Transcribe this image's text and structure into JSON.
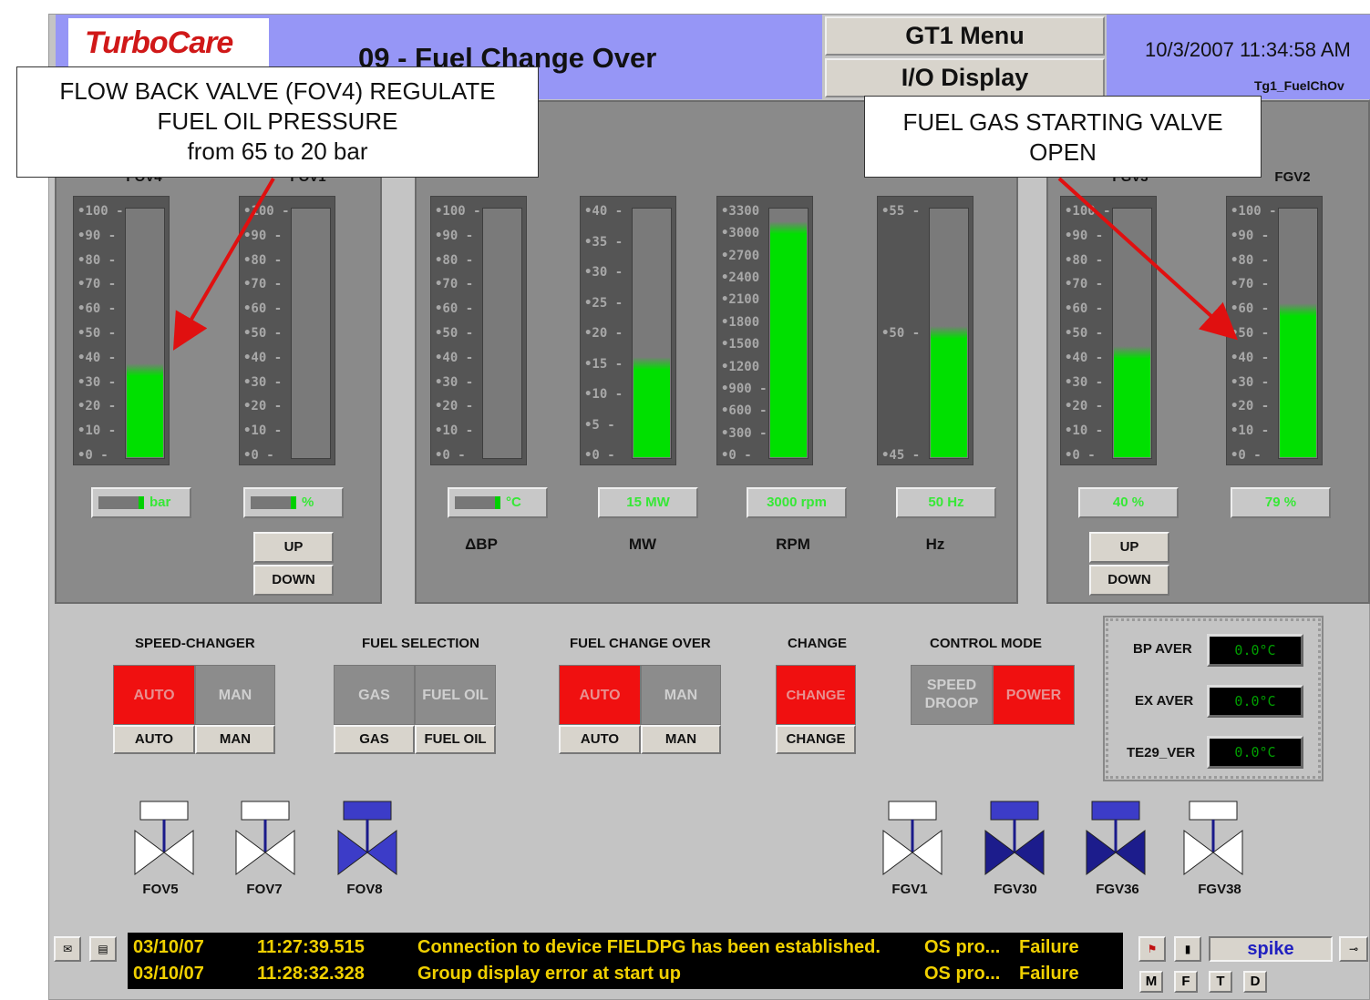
{
  "header": {
    "logo": "TurboCare",
    "title": "09 - Fuel Change Over",
    "menu_button": "GT1 Menu",
    "io_button": "I/O Display",
    "datetime": "10/3/2007 11:34:58 AM",
    "screen_id": "Tg1_FuelChOv"
  },
  "callouts": {
    "left_line1": "FLOW BACK VALVE (FOV4) REGULATE",
    "left_line2": "FUEL OIL PRESSURE",
    "left_line3": "from 65 to 20 bar",
    "right_line1": "FUEL GAS STARTING VALVE",
    "right_line2": "OPEN"
  },
  "gauges": {
    "fov4": {
      "label": "FOV4",
      "fill": 0.35,
      "readout": "bar"
    },
    "fov1": {
      "label": "FOV1",
      "fill": 0,
      "readout": "%"
    },
    "dbp": {
      "label": "ΔBP",
      "fill": 0,
      "readout": "°C"
    },
    "mw": {
      "label": "MW",
      "fill": 0.375,
      "readout": "15 MW"
    },
    "rpm": {
      "label": "RPM",
      "fill": 0.92,
      "readout": "3000 rpm"
    },
    "hz": {
      "label": "Hz",
      "fill": 0.5,
      "readout": "50 Hz"
    },
    "fgv3": {
      "label": "FGV3",
      "fill": 0.42,
      "readout": "40 %"
    },
    "fgv2": {
      "label": "FGV2",
      "fill": 0.59,
      "readout": "79 %"
    }
  },
  "scales": {
    "pct": [
      "100",
      "90",
      "80",
      "70",
      "60",
      "50",
      "40",
      "30",
      "20",
      "10",
      "0"
    ],
    "mw": [
      "40",
      "35",
      "30",
      "25",
      "20",
      "15",
      "10",
      "5",
      "0"
    ],
    "rpm": [
      "3300",
      "3000",
      "2700",
      "2400",
      "2100",
      "1800",
      "1500",
      "1200",
      "900",
      "600",
      "300",
      "0"
    ],
    "hz": [
      "55",
      "50",
      "45"
    ]
  },
  "buttons": {
    "up": "UP",
    "down": "DOWN"
  },
  "groups": {
    "speed_changer": {
      "title": "SPEED-CHANGER",
      "state_a": "AUTO",
      "state_b": "MAN",
      "btn_a": "AUTO",
      "btn_b": "MAN"
    },
    "fuel_selection": {
      "title": "FUEL SELECTION",
      "state_a": "GAS",
      "state_b": "FUEL OIL",
      "btn_a": "GAS",
      "btn_b": "FUEL OIL"
    },
    "fuel_change_over": {
      "title": "FUEL CHANGE OVER",
      "state_a": "AUTO",
      "state_b": "MAN",
      "btn_a": "AUTO",
      "btn_b": "MAN"
    },
    "change": {
      "title": "CHANGE",
      "state_a": "CHANGE",
      "btn_a": "CHANGE"
    },
    "control_mode": {
      "title": "CONTROL MODE",
      "state_a_1": "SPEED",
      "state_a_2": "DROOP",
      "state_b": "POWER"
    }
  },
  "temps": [
    {
      "label": "BP AVER",
      "value": "0.0°C"
    },
    {
      "label": "EX AVER",
      "value": "0.0°C"
    },
    {
      "label": "TE29_VER",
      "value": "0.0°C"
    }
  ],
  "valves": {
    "fov5": "FOV5",
    "fov7": "FOV7",
    "fov8": "FOV8",
    "fgv1": "FGV1",
    "fgv30": "FGV30",
    "fgv36": "FGV36",
    "fgv38": "FGV38"
  },
  "alarms": [
    {
      "date": "03/10/07",
      "time": "11:27:39.515",
      "message": "Connection to device FIELDPG has been established.",
      "source": "OS pro...",
      "status": "Failure"
    },
    {
      "date": "03/10/07",
      "time": "11:28:32.328",
      "message": "Group display error at start up",
      "source": "OS pro...",
      "status": "Failure"
    }
  ],
  "user": "spike",
  "bottom_buttons": [
    "M",
    "F",
    "T",
    "D"
  ],
  "colors": {
    "green": "#00e000",
    "red": "#f01010",
    "blue": "#3c3cc8",
    "header": "#9696f6"
  }
}
